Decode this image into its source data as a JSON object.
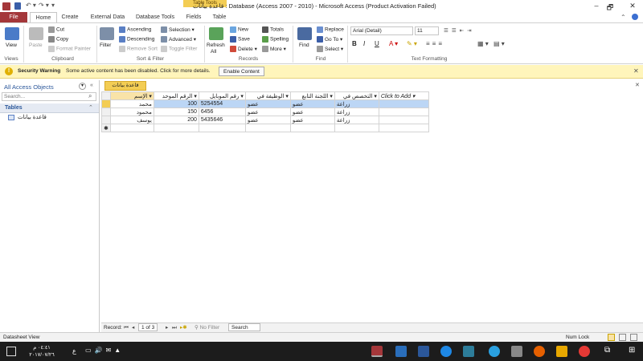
{
  "window": {
    "title": "قاعدة بيانات : Database (Access 2007 - 2010) - Microsoft Access (Product Activation Failed)",
    "contextual_tab": "Table Tools",
    "controls": [
      "?",
      "🗗",
      "✕"
    ]
  },
  "tabs": [
    "File",
    "Home",
    "Create",
    "External Data",
    "Database Tools",
    "Fields",
    "Table"
  ],
  "ribbon": {
    "views": {
      "view": "View",
      "label": "Views"
    },
    "clipboard": {
      "paste": "Paste",
      "cut": "Cut",
      "copy": "Copy",
      "format_painter": "Format Painter",
      "label": "Clipboard"
    },
    "sort_filter": {
      "filter": "Filter",
      "ascending": "Ascending",
      "descending": "Descending",
      "remove_sort": "Remove Sort",
      "selection": "Selection",
      "advanced": "Advanced",
      "toggle_filter": "Toggle Filter",
      "label": "Sort & Filter"
    },
    "records": {
      "refresh": "Refresh",
      "refresh2": "All",
      "new": "New",
      "save": "Save",
      "delete": "Delete",
      "totals": "Totals",
      "spelling": "Spelling",
      "more": "More",
      "label": "Records"
    },
    "find": {
      "find": "Find",
      "replace": "Replace",
      "goto": "Go To",
      "select": "Select",
      "label": "Find"
    },
    "text": {
      "font": "Arial (Detail)",
      "size": "11",
      "label": "Text Formatting"
    }
  },
  "message": {
    "title": "Security Warning",
    "text": "Some active content has been disabled. Click for more details.",
    "button": "Enable Content"
  },
  "nav": {
    "header": "All Access Objects",
    "search_placeholder": "Search...",
    "section": "Tables",
    "item": "قاعدة بيانات"
  },
  "doc_tab": "قاعدة بيانات",
  "table": {
    "headers": [
      "الإسم",
      "الرقم الموحد",
      "رقم الموبايل",
      "الوظيفة في",
      "اللجنة التابع",
      "التخصص في",
      "Click to Add"
    ],
    "rows": [
      [
        "محمد",
        "100",
        "5254554",
        "عضو",
        "عضو",
        "زراعة"
      ],
      [
        "محمود",
        "150",
        "6456",
        "عضو",
        "عضو",
        "زراعة"
      ],
      [
        "يوسف",
        "200",
        "5435646",
        "عضو",
        "عضو",
        "زراعة"
      ]
    ]
  },
  "record_nav": {
    "label": "Record:",
    "position": "1 of 3",
    "filter": "No Filter",
    "search": "Search"
  },
  "status": {
    "left": "Datasheet View",
    "right": "Num Lock"
  },
  "taskbar": {
    "lang": "ع",
    "time": "٠٤:٤١ م",
    "date": "٢٠١٧/٠٧/٢٦"
  }
}
